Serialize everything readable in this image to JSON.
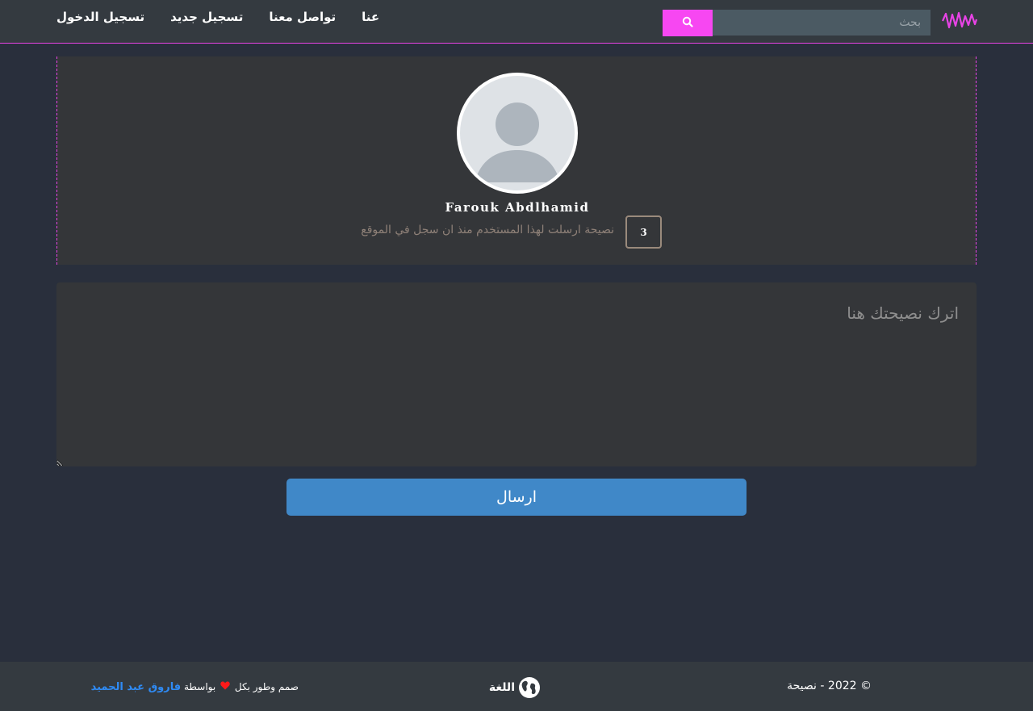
{
  "header": {
    "search_placeholder": "بحث",
    "nav": {
      "about": "عنا",
      "contact": "تواصل معنا",
      "register": "تسجيل جديد",
      "login": "تسجيل الدخول"
    },
    "icons": {
      "logo": "wave-logo-icon",
      "search": "search-icon"
    },
    "accent_color": "#f747f2"
  },
  "profile": {
    "name": "Farouk Abdlhamid",
    "advice_count": "3",
    "advice_count_label": "نصيحة ارسلت لهذا المستخدم منذ ان سجل في الموقع"
  },
  "form": {
    "textarea_placeholder": "اترك نصيحتك هنا",
    "submit_label": "ارسال",
    "submit_color": "#4088c8"
  },
  "footer": {
    "copyright": "© 2022 - نصيحة",
    "language_label": "اللغة",
    "credit_prefix": "صمم وطور بكل",
    "credit_by": "بواسطة",
    "credit_author": "فاروق عبد الحميد"
  }
}
